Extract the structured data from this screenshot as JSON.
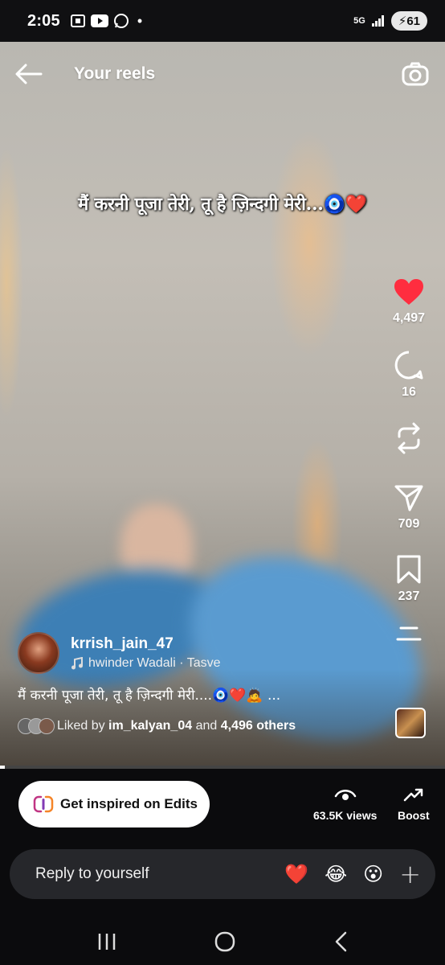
{
  "status_bar": {
    "time": "2:05",
    "network": "5G",
    "battery": "61"
  },
  "header": {
    "title": "Your reels"
  },
  "overlay_text": "मैं करनी पूजा तेरी, तू है ज़िन्दगी मेरी...🧿❤️",
  "actions": {
    "likes": "4,497",
    "comments": "16",
    "shares": "709",
    "saves": "237"
  },
  "post": {
    "username": "krrish_jain_47",
    "audio": "hwinder Wadali · Tasve",
    "caption": "मैं करनी पूजा तेरी, तू है ज़िन्दगी मेरी....🧿❤️🙇 ...",
    "liked_prefix": "Liked by ",
    "liked_user": "im_kalyan_04",
    "liked_mid": " and ",
    "liked_others": "4,496 others"
  },
  "playback": {
    "progress": 0.01
  },
  "bottom": {
    "edits_label": "Get inspired on Edits",
    "views_label": "63.5K views",
    "boost_label": "Boost",
    "reply_placeholder": "Reply to yourself",
    "reactions": [
      "❤️",
      "😂",
      "😮"
    ],
    "add_reaction": "+"
  },
  "colors": {
    "like_red": "#ff2d3f",
    "background": "#0b0b0d",
    "reply_bar": "#26272b"
  }
}
